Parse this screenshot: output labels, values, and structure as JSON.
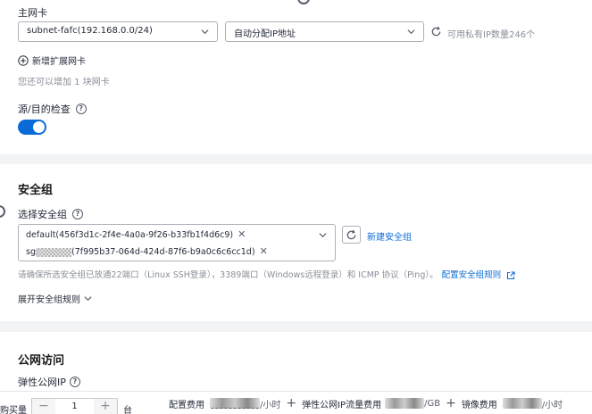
{
  "nic": {
    "title": "主网卡",
    "subnet_value": "subnet-fafc(192.168.0.0/24)",
    "ip_mode_value": "自动分配IP地址",
    "ip_count_text": "可用私有IP数量246个",
    "add_nic_label": "新增扩展网卡",
    "add_nic_hint": "您还可以增加 1 块网卡"
  },
  "src_dst_check": {
    "label": "源/目的检查",
    "enabled": true
  },
  "security_group": {
    "title": "安全组",
    "select_label": "选择安全组",
    "tags": [
      {
        "text": "default(456f3d1c-2f4e-4a0a-9f26-b33fb1f4d6c9)"
      },
      {
        "prefix": "sg",
        "text": "(7f995b37-064d-424d-87f6-b9a0c6c6cc1d)"
      }
    ],
    "create_link": "新建安全组",
    "notice": "请确保所选安全组已放通22端口（Linux SSH登录），3389端口（Windows远程登录）和 ICMP 协议（Ping）。",
    "configure_rules_link": "配置安全组规则",
    "expand_rules_label": "展开安全组规则"
  },
  "public_access": {
    "title": "公网访问",
    "eip_label": "弹性公网IP"
  },
  "footer": {
    "quantity_label": "购买量",
    "quantity_value": "1",
    "quantity_unit": "台",
    "config_fee_label": "配置费用",
    "config_fee_unit": "/小时",
    "eip_fee_label": "弹性公网IP流量费用",
    "eip_fee_unit": "/GB",
    "image_fee_label": "镜像费用",
    "image_fee_unit": "/小时",
    "plus": "+"
  },
  "colors": {
    "accent": "#0b6bd6",
    "page_bg": "#f2f3f5"
  }
}
